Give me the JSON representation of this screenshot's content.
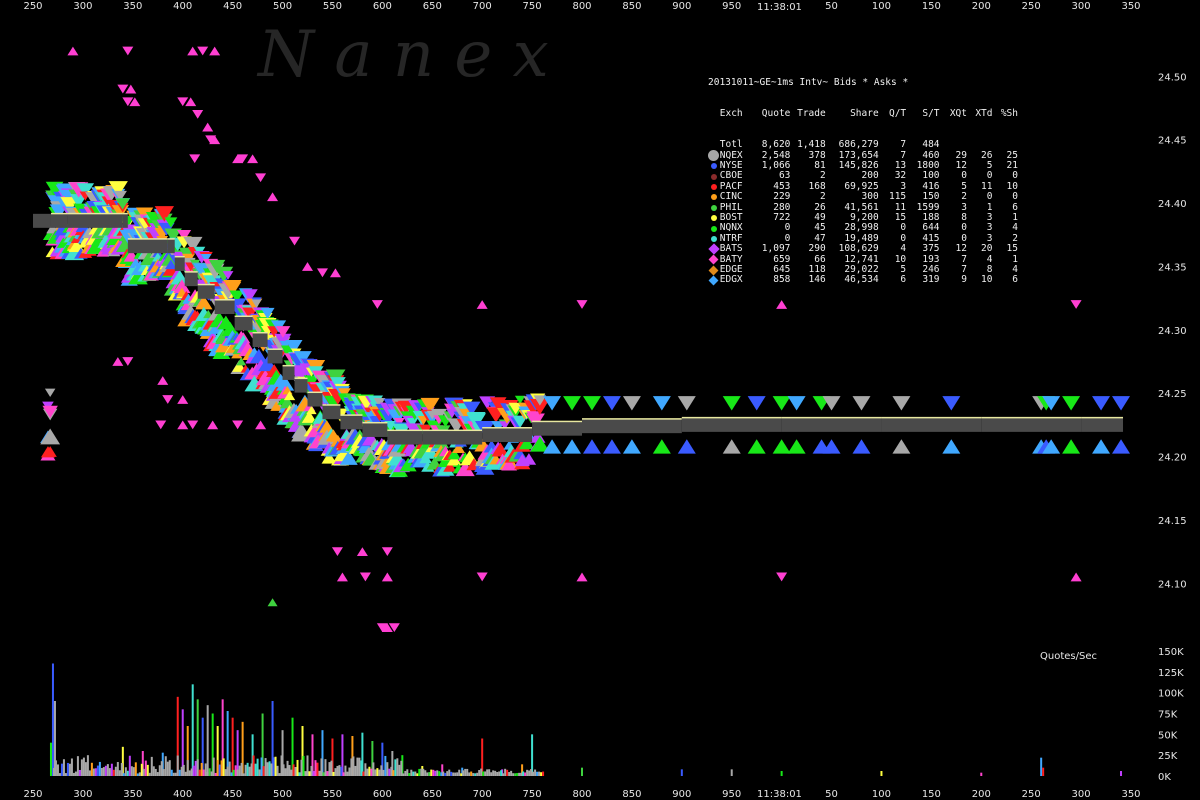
{
  "time_labels": {
    "top": "11:38:01",
    "bottom": "11:38:01"
  },
  "watermark": "N a n e x",
  "volume_label": "Quotes/Sec",
  "legend": {
    "title": "20131011~GE~1ms Intv~ Bids * Asks *",
    "columns": [
      "Exch",
      "Quote",
      "Trade",
      "Share",
      "Q/T",
      "S/T",
      "XQt",
      "XTd",
      "%Sh"
    ],
    "rows": [
      {
        "exch": "Totl",
        "quote": "8,620",
        "trade": "1,418",
        "share": "686,279",
        "qt": "7",
        "st": "484",
        "xqt": "",
        "xtd": "",
        "sh": "",
        "color": "",
        "marker": "none"
      },
      {
        "exch": "NQEX",
        "quote": "2,548",
        "trade": "378",
        "share": "173,654",
        "qt": "7",
        "st": "460",
        "xqt": "29",
        "xtd": "26",
        "sh": "25",
        "color": "#a8a8a8",
        "marker": "bigdot"
      },
      {
        "exch": "NYSE",
        "quote": "1,066",
        "trade": "81",
        "share": "145,826",
        "qt": "13",
        "st": "1800",
        "xqt": "12",
        "xtd": "5",
        "sh": "21",
        "color": "#3a5bff",
        "marker": "dot"
      },
      {
        "exch": "CBOE",
        "quote": "63",
        "trade": "2",
        "share": "200",
        "qt": "32",
        "st": "100",
        "xqt": "0",
        "xtd": "0",
        "sh": "0",
        "color": "#8a2b2b",
        "marker": "dot"
      },
      {
        "exch": "PACF",
        "quote": "453",
        "trade": "168",
        "share": "69,925",
        "qt": "3",
        "st": "416",
        "xqt": "5",
        "xtd": "11",
        "sh": "10",
        "color": "#ff2020",
        "marker": "dot"
      },
      {
        "exch": "CINC",
        "quote": "229",
        "trade": "2",
        "share": "300",
        "qt": "115",
        "st": "150",
        "xqt": "2",
        "xtd": "0",
        "sh": "0",
        "color": "#ff9f1a",
        "marker": "dot"
      },
      {
        "exch": "PHIL",
        "quote": "280",
        "trade": "26",
        "share": "41,561",
        "qt": "11",
        "st": "1599",
        "xqt": "3",
        "xtd": "1",
        "sh": "6",
        "color": "#3fd23f",
        "marker": "dot"
      },
      {
        "exch": "BOST",
        "quote": "722",
        "trade": "49",
        "share": "9,200",
        "qt": "15",
        "st": "188",
        "xqt": "8",
        "xtd": "3",
        "sh": "1",
        "color": "#ffff40",
        "marker": "dot"
      },
      {
        "exch": "NQNX",
        "quote": "0",
        "trade": "45",
        "share": "28,998",
        "qt": "0",
        "st": "644",
        "xqt": "0",
        "xtd": "3",
        "sh": "4",
        "color": "#18e818",
        "marker": "dot"
      },
      {
        "exch": "NTRF",
        "quote": "0",
        "trade": "47",
        "share": "19,489",
        "qt": "0",
        "st": "415",
        "xqt": "0",
        "xtd": "3",
        "sh": "2",
        "color": "#40e0d0",
        "marker": "dot"
      },
      {
        "exch": "BATS",
        "quote": "1,097",
        "trade": "290",
        "share": "108,629",
        "qt": "4",
        "st": "375",
        "xqt": "12",
        "xtd": "20",
        "sh": "15",
        "color": "#c040ff",
        "marker": "bigdia"
      },
      {
        "exch": "BATY",
        "quote": "659",
        "trade": "66",
        "share": "12,741",
        "qt": "10",
        "st": "193",
        "xqt": "7",
        "xtd": "4",
        "sh": "1",
        "color": "#ff44cc",
        "marker": "dia"
      },
      {
        "exch": "EDGE",
        "quote": "645",
        "trade": "118",
        "share": "29,022",
        "qt": "5",
        "st": "246",
        "xqt": "7",
        "xtd": "8",
        "sh": "4",
        "color": "#e08a1a",
        "marker": "dia"
      },
      {
        "exch": "EDGX",
        "quote": "858",
        "trade": "146",
        "share": "46,534",
        "qt": "6",
        "st": "319",
        "xqt": "9",
        "xtd": "10",
        "sh": "6",
        "color": "#40a8ff",
        "marker": "dia"
      }
    ]
  },
  "chart_data": {
    "type": "scatter",
    "x_ticks": [
      250,
      300,
      350,
      400,
      450,
      500,
      550,
      600,
      650,
      700,
      750,
      800,
      850,
      900,
      950,
      1000,
      1050,
      1100,
      1150,
      1200,
      1250,
      1300,
      1350
    ],
    "x_tick_labels": [
      "250",
      "300",
      "350",
      "400",
      "450",
      "500",
      "550",
      "600",
      "650",
      "700",
      "750",
      "800",
      "850",
      "900",
      "950",
      "",
      "50",
      "100",
      "150",
      "200",
      "250",
      "300",
      "350"
    ],
    "xlim": [
      250,
      1350
    ],
    "ylim": [
      24.045,
      24.55
    ],
    "y_ticks": [
      24.1,
      24.15,
      24.2,
      24.25,
      24.3,
      24.35,
      24.4,
      24.45,
      24.5
    ],
    "y_tick_labels": [
      "24.10",
      "24.15",
      "24.20",
      "24.25",
      "24.30",
      "24.35",
      "24.40",
      "24.45",
      "24.50"
    ],
    "volume_ylim": [
      0,
      150
    ],
    "volume_ticks": [
      0,
      25,
      50,
      75,
      100,
      125,
      150
    ],
    "volume_tick_labels": [
      "0K",
      "25K",
      "50K",
      "75K",
      "100K",
      "125K",
      "150K"
    ],
    "nbbo_path": [
      [
        268,
        24.386
      ],
      [
        285,
        24.386
      ],
      [
        340,
        24.386
      ],
      [
        345,
        24.366
      ],
      [
        385,
        24.366
      ],
      [
        392,
        24.352
      ],
      [
        402,
        24.34
      ],
      [
        415,
        24.33
      ],
      [
        432,
        24.318
      ],
      [
        452,
        24.305
      ],
      [
        470,
        24.292
      ],
      [
        485,
        24.279
      ],
      [
        500,
        24.266
      ],
      [
        512,
        24.256
      ],
      [
        525,
        24.245
      ],
      [
        540,
        24.235
      ],
      [
        558,
        24.227
      ],
      [
        580,
        24.221
      ],
      [
        605,
        24.215
      ],
      [
        640,
        24.215
      ],
      [
        700,
        24.217
      ],
      [
        750,
        24.222
      ],
      [
        800,
        24.224
      ],
      [
        900,
        24.225
      ],
      [
        1000,
        24.225
      ],
      [
        1100,
        24.225
      ],
      [
        1200,
        24.225
      ],
      [
        1300,
        24.225
      ],
      [
        1342,
        24.225
      ]
    ],
    "outer_bids": [
      [
        290,
        24.52
      ],
      [
        345,
        24.52
      ],
      [
        410,
        24.52
      ],
      [
        420,
        24.52
      ],
      [
        432,
        24.52
      ],
      [
        340,
        24.49
      ],
      [
        348,
        24.49
      ],
      [
        345,
        24.48
      ],
      [
        352,
        24.48
      ],
      [
        400,
        24.48
      ],
      [
        408,
        24.48
      ],
      [
        415,
        24.47
      ],
      [
        425,
        24.46
      ],
      [
        428,
        24.45
      ],
      [
        432,
        24.45
      ],
      [
        412,
        24.435
      ],
      [
        455,
        24.435
      ],
      [
        460,
        24.435
      ],
      [
        470,
        24.435
      ],
      [
        478,
        24.42
      ],
      [
        490,
        24.405
      ],
      [
        512,
        24.37
      ],
      [
        525,
        24.35
      ],
      [
        540,
        24.345
      ],
      [
        553,
        24.345
      ],
      [
        595,
        24.32
      ],
      [
        700,
        24.32
      ],
      [
        800,
        24.32
      ],
      [
        1000,
        24.32
      ],
      [
        1295,
        24.32
      ],
      [
        335,
        24.275
      ],
      [
        345,
        24.275
      ],
      [
        380,
        24.26
      ],
      [
        385,
        24.245
      ],
      [
        400,
        24.245
      ],
      [
        378,
        24.225
      ],
      [
        400,
        24.225
      ],
      [
        410,
        24.225
      ],
      [
        430,
        24.225
      ],
      [
        455,
        24.225
      ],
      [
        478,
        24.225
      ],
      [
        555,
        24.125
      ],
      [
        580,
        24.125
      ],
      [
        605,
        24.125
      ],
      [
        560,
        24.105
      ],
      [
        583,
        24.105
      ],
      [
        605,
        24.105
      ],
      [
        700,
        24.105
      ],
      [
        800,
        24.105
      ],
      [
        1000,
        24.105
      ],
      [
        1295,
        24.105
      ],
      [
        600,
        24.065
      ],
      [
        605,
        24.065
      ],
      [
        612,
        24.065
      ]
    ],
    "green_marker": [
      490,
      24.085
    ],
    "price_colors": [
      "#3a5bff",
      "#a8a8a8",
      "#18e818",
      "#ffff40",
      "#ff44cc",
      "#40a8ff",
      "#ff2020",
      "#c040ff",
      "#ff9f1a",
      "#40e0d0",
      "#3fd23f"
    ],
    "volume_bars": [
      [
        270,
        135
      ],
      [
        272,
        90
      ],
      [
        268,
        40
      ],
      [
        340,
        35
      ],
      [
        360,
        30
      ],
      [
        380,
        28
      ],
      [
        395,
        95
      ],
      [
        400,
        80
      ],
      [
        405,
        60
      ],
      [
        410,
        110
      ],
      [
        415,
        92
      ],
      [
        420,
        70
      ],
      [
        425,
        85
      ],
      [
        430,
        75
      ],
      [
        435,
        60
      ],
      [
        440,
        92
      ],
      [
        445,
        78
      ],
      [
        450,
        70
      ],
      [
        455,
        55
      ],
      [
        460,
        65
      ],
      [
        470,
        50
      ],
      [
        480,
        75
      ],
      [
        490,
        90
      ],
      [
        500,
        55
      ],
      [
        510,
        70
      ],
      [
        520,
        60
      ],
      [
        530,
        50
      ],
      [
        540,
        55
      ],
      [
        550,
        45
      ],
      [
        560,
        50
      ],
      [
        570,
        48
      ],
      [
        580,
        52
      ],
      [
        590,
        42
      ],
      [
        600,
        40
      ],
      [
        610,
        30
      ],
      [
        620,
        25
      ],
      [
        640,
        12
      ],
      [
        660,
        14
      ],
      [
        680,
        10
      ],
      [
        700,
        45
      ],
      [
        720,
        8
      ],
      [
        740,
        14
      ],
      [
        750,
        50
      ],
      [
        800,
        10
      ],
      [
        900,
        8
      ],
      [
        950,
        8
      ],
      [
        1000,
        6
      ],
      [
        1100,
        6
      ],
      [
        1200,
        4
      ],
      [
        1260,
        22
      ],
      [
        1262,
        10
      ],
      [
        1340,
        6
      ]
    ]
  }
}
